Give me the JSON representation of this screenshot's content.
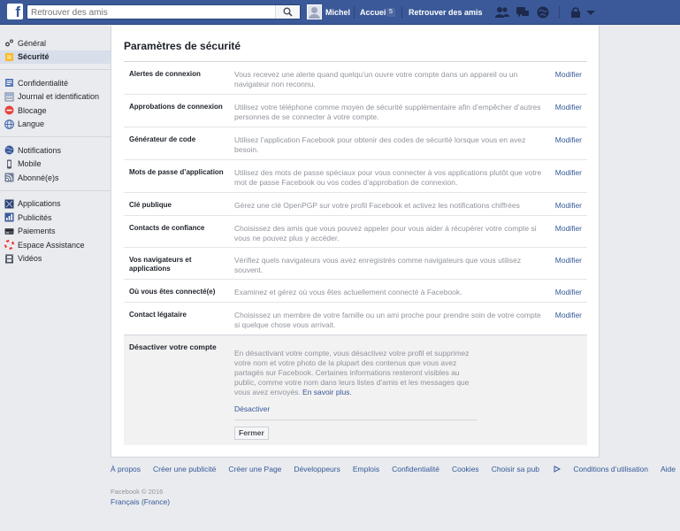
{
  "topbar": {
    "logo": "f",
    "search_placeholder": "Retrouver des amis",
    "user_name": "Michel",
    "home_label": "Accueil",
    "home_badge": "5",
    "find_friends_label": "Retrouver des amis",
    "icons": [
      "friend-requests-icon",
      "messages-icon",
      "notifications-globe-icon",
      "privacy-lock-icon",
      "account-menu-icon"
    ]
  },
  "sidebar": {
    "groups": [
      [
        {
          "label": "Général",
          "icon": "gear-icon",
          "active": false
        },
        {
          "label": "Sécurité",
          "icon": "shield-icon",
          "active": true
        }
      ],
      [
        {
          "label": "Confidentialité",
          "icon": "privacy-icon",
          "active": false
        },
        {
          "label": "Journal et identification",
          "icon": "timeline-icon",
          "active": false
        },
        {
          "label": "Blocage",
          "icon": "blocking-icon",
          "active": false
        },
        {
          "label": "Langue",
          "icon": "language-icon",
          "active": false
        }
      ],
      [
        {
          "label": "Notifications",
          "icon": "globe-icon",
          "active": false
        },
        {
          "label": "Mobile",
          "icon": "mobile-icon",
          "active": false
        },
        {
          "label": "Abonné(e)s",
          "icon": "rss-icon",
          "active": false
        }
      ],
      [
        {
          "label": "Applications",
          "icon": "apps-icon",
          "active": false
        },
        {
          "label": "Publicités",
          "icon": "ads-icon",
          "active": false
        },
        {
          "label": "Paiements",
          "icon": "card-icon",
          "active": false
        },
        {
          "label": "Espace Assistance",
          "icon": "lifebuoy-icon",
          "active": false
        },
        {
          "label": "Vidéos",
          "icon": "film-icon",
          "active": false
        }
      ]
    ]
  },
  "main": {
    "title": "Paramètres de sécurité",
    "edit_label": "Modifier",
    "rows": [
      {
        "label": "Alertes de connexion",
        "desc": "Vous recevez une alerte quand quelqu’un ouvre votre compte dans un appareil ou un navigateur non reconnu."
      },
      {
        "label": "Approbations de connexion",
        "desc": "Utilisez votre téléphone comme moyen de sécurité supplémentaire afin d’empêcher d’autres personnes de se connecter à votre compte."
      },
      {
        "label": "Générateur de code",
        "desc": "Utilisez l’application Facebook pour obtenir des codes de sécurité lorsque vous en avez besoin."
      },
      {
        "label": "Mots de passe d’application",
        "desc": "Utilisez des mots de passe spéciaux pour vous connecter à vos applications plutôt que votre mot de passe Facebook ou vos codes d’approbation de connexion."
      },
      {
        "label": "Clé publique",
        "desc": "Gérez une clé OpenPGP sur votre profil Facebook et activez les notifications chiffrées"
      },
      {
        "label": "Contacts de confiance",
        "desc": "Choisissez des amis que vous pouvez appeler pour vous aider à récupérer votre compte si vous ne pouvez plus y accéder."
      },
      {
        "label": "Vos navigateurs et applications",
        "desc": "Vérifiez quels navigateurs vous avez enregistrés comme navigateurs que vous utilisez souvent."
      },
      {
        "label": "Où vous êtes connecté(e)",
        "desc": "Examinez et gérez où vous êtes actuellement connecté à Facebook."
      },
      {
        "label": "Contact légataire",
        "desc": "Choisissez un membre de votre famille ou un ami proche pour prendre soin de votre compte si quelque chose vous arrivait."
      }
    ],
    "deactivate": {
      "title": "Désactiver votre compte",
      "desc": "En désactivant votre compte, vous désactivez votre profil et supprimez votre nom et votre photo de la plupart des contenus que vous avez partagés sur Facebook. Certaines informations resteront visibles au public, comme votre nom dans leurs listes d’amis et les messages que vous avez envoyés.",
      "more_link": "En savoir plus.",
      "action_link": "Désactiver",
      "close_button": "Fermer"
    }
  },
  "footer": {
    "links": [
      "À propos",
      "Créer une publicité",
      "Créer une Page",
      "Développeurs",
      "Emplois",
      "Confidentialité",
      "Cookies",
      "Choisir sa pub",
      "Conditions d’utilisation",
      "Aide"
    ],
    "copyright": "Facebook © 2016",
    "language": "Français (France)"
  }
}
